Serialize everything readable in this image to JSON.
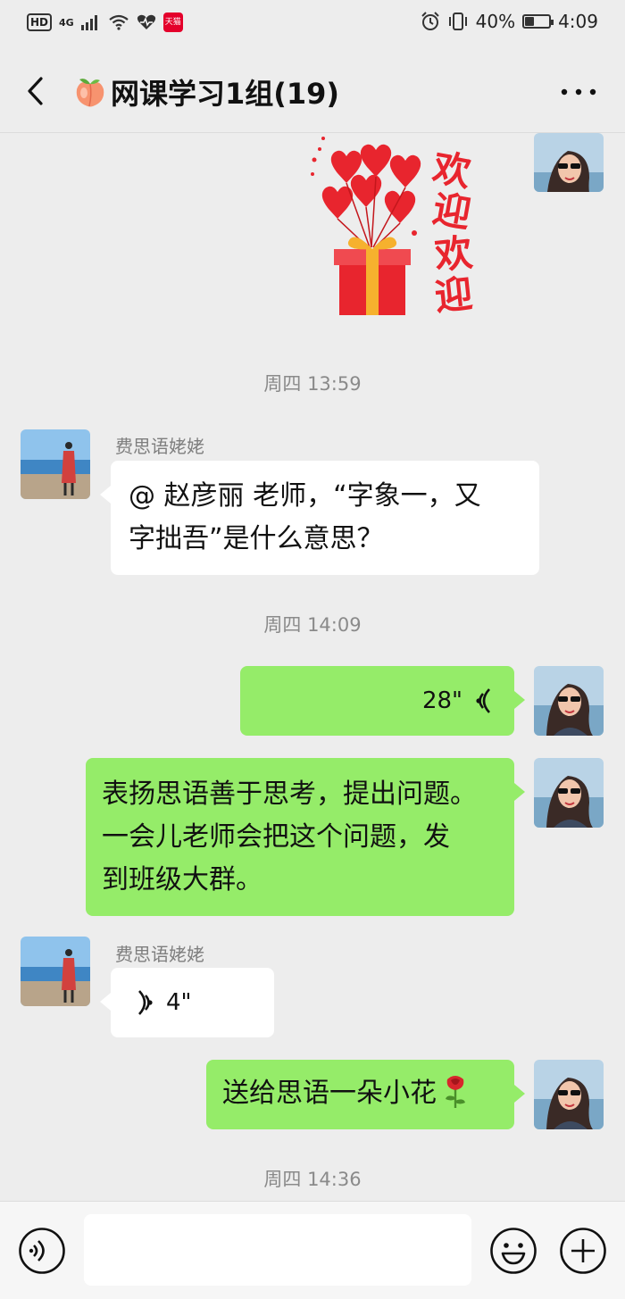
{
  "status_bar": {
    "hd": "HD",
    "network": "4G",
    "battery": "40%",
    "battery_level": 0.4,
    "time": "4:09",
    "app_badge": "天猫"
  },
  "header": {
    "title": "网课学习1组(19)",
    "title_icon": "peach-emoji",
    "back_icon": "chevron-left-icon",
    "more_icon": "more-dots-icon"
  },
  "sticker": {
    "text_lines": [
      "欢迎",
      "欢迎"
    ]
  },
  "messages": [
    {
      "type": "time",
      "text": "周四 13:59"
    },
    {
      "type": "text",
      "side": "left",
      "sender": "费思语姥姥",
      "text_lines": [
        "@ 赵彦丽 老师，“字象一，又",
        "字拙吾”是什么意思？"
      ]
    },
    {
      "type": "time",
      "text": "周四 14:09"
    },
    {
      "type": "voice",
      "side": "right",
      "duration": "28\""
    },
    {
      "type": "text",
      "side": "right",
      "text_lines": [
        "表扬思语善于思考，提出问题。",
        "一会儿老师会把这个问题，发",
        "到班级大群。"
      ]
    },
    {
      "type": "voice",
      "side": "left",
      "sender": "费思语姥姥",
      "duration": "4\""
    },
    {
      "type": "text",
      "side": "right",
      "text": "送给思语一朵小花",
      "emoji": "rose-icon"
    },
    {
      "type": "time",
      "text": "周四 14:36"
    }
  ],
  "input": {
    "placeholder": "",
    "value": ""
  },
  "colors": {
    "background": "#ededed",
    "bubble_green": "#95ec69",
    "bubble_white": "#ffffff"
  }
}
